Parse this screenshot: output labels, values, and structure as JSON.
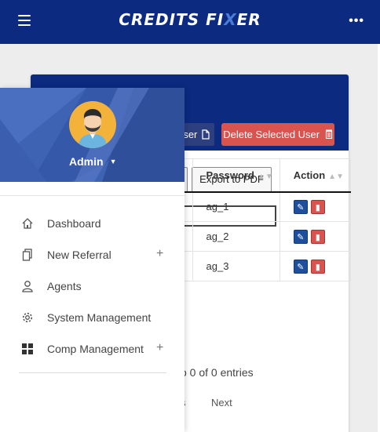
{
  "header": {
    "logo_main": "CREDITS FI",
    "logo_x": "X",
    "logo_tail": "ER",
    "more_glyph": "•••"
  },
  "card": {
    "add_user_label": "ser",
    "delete_label": "Delete Selected User",
    "export_pdf_label": "Export to PDF",
    "table": {
      "columns": [
        "Password",
        "Action"
      ],
      "rows": [
        {
          "password": "ag_1"
        },
        {
          "password": "ag_2"
        },
        {
          "password": "ag_3"
        }
      ]
    },
    "info_text": "o 0 of 0 entries",
    "prev_label": "s",
    "next_label": "Next"
  },
  "drawer": {
    "user_name": "Admin",
    "items": [
      {
        "label": "Dashboard",
        "icon": "home-icon",
        "expandable": false
      },
      {
        "label": "New Referral",
        "icon": "documents-icon",
        "expandable": true
      },
      {
        "label": "Agents",
        "icon": "user-icon",
        "expandable": false
      },
      {
        "label": "System Management",
        "icon": "gear-icon",
        "expandable": false
      },
      {
        "label": "Comp Management",
        "icon": "grid-icon",
        "expandable": true
      }
    ],
    "plus_glyph": "+"
  },
  "colors": {
    "brand_navy": "#0b2a80",
    "danger": "#d9534f",
    "avatar_bg": "#f3b33b"
  }
}
